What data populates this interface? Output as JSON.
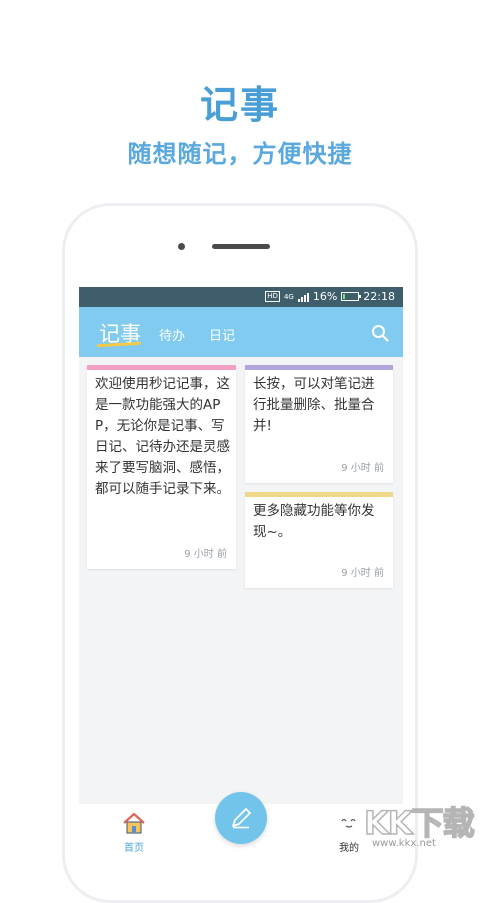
{
  "promo": {
    "title": "记事",
    "subtitle": "随想随记，方便快捷"
  },
  "status_bar": {
    "hd": "HD",
    "network": "4G",
    "battery": "16%",
    "battery_level": 0.16,
    "time": "22:18"
  },
  "app_bar": {
    "tabs": [
      {
        "label": "记事",
        "active": true
      },
      {
        "label": "待办",
        "active": false
      },
      {
        "label": "日记",
        "active": false
      }
    ],
    "search_icon": "search-icon"
  },
  "notes": [
    {
      "text": "欢迎使用秒记记事，这是一款功能强大的APP，无论你是记事、写日记、记待办还是灵感来了要写脑洞、感悟，都可以随手记录下来。",
      "time": "9 小时 前",
      "color": "#f2a1c4"
    },
    {
      "text": "长按，可以对笔记进行批量删除、批量合并!",
      "time": "9 小时 前",
      "color": "#b3a6dc"
    },
    {
      "text": "更多隐藏功能等你发现~。",
      "time": "9 小时 前",
      "color": "#f0d88a"
    }
  ],
  "bottom_nav": {
    "home_label": "首页",
    "mine_label": "我的"
  },
  "watermark": {
    "logo": "KK下载",
    "url": "www.kkx.net"
  },
  "colors": {
    "accent": "#80cbef",
    "title_blue": "#4a9ed6",
    "status_bar": "#3f5e6c"
  }
}
